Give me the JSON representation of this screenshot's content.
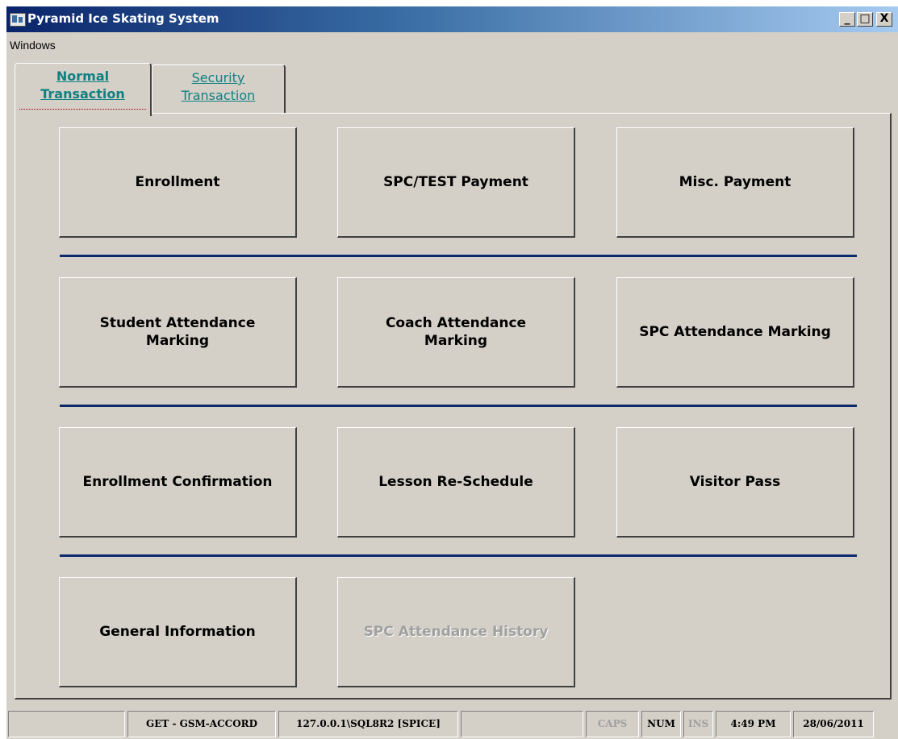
{
  "window": {
    "title": "Pyramid Ice Skating System",
    "minimize_label": "_",
    "maximize_label": "□",
    "close_label": "X"
  },
  "menu": {
    "items": [
      "Windows"
    ]
  },
  "tabs": [
    {
      "line1": "Normal",
      "line2": "Transaction",
      "active": true
    },
    {
      "line1": "Security",
      "line2": "Transaction",
      "active": false
    }
  ],
  "buttons": [
    {
      "label": "Enrollment",
      "enabled": true
    },
    {
      "label": "SPC/TEST Payment",
      "enabled": true
    },
    {
      "label": "Misc. Payment",
      "enabled": true
    },
    {
      "label": "Student Attendance\nMarking",
      "enabled": true
    },
    {
      "label": "Coach Attendance\nMarking",
      "enabled": true
    },
    {
      "label": "SPC Attendance Marking",
      "enabled": true
    },
    {
      "label": "Enrollment Confirmation",
      "enabled": true
    },
    {
      "label": "Lesson Re-Schedule",
      "enabled": true
    },
    {
      "label": "Visitor Pass",
      "enabled": true
    },
    {
      "label": "General Information",
      "enabled": true
    },
    {
      "label": "SPC Attendance History",
      "enabled": false
    }
  ],
  "statusbar": {
    "cells": [
      "",
      "GET - GSM-ACCORD",
      "127.0.0.1\\SQL8R2 [SPICE]",
      "",
      "CAPS",
      "NUM",
      "INS",
      "4:49 PM",
      "28/06/2011"
    ],
    "dim": [
      false,
      false,
      false,
      false,
      true,
      false,
      true,
      false,
      false
    ]
  },
  "colors": {
    "face": "#d4d0c8",
    "title_start": "#0a246a",
    "title_end": "#a6caf0",
    "tab_link": "#108080",
    "separator": "#0b2a6e",
    "disabled_text": "#a0a0a0"
  }
}
